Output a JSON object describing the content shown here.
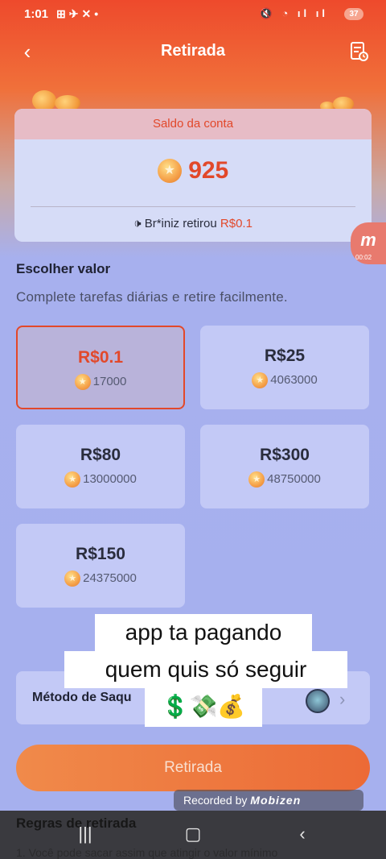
{
  "status_bar": {
    "time": "1:01",
    "battery": "37"
  },
  "header": {
    "title": "Retirada",
    "back_icon": "back-arrow-icon",
    "record_icon": "history-icon"
  },
  "balance": {
    "heading": "Saldo da conta",
    "value": "925",
    "notice_prefix": "Br*iniz retirou ",
    "notice_amount": "R$0.1"
  },
  "section": {
    "title": "Escolher valor",
    "description": "Complete tarefas diárias e retire facilmente."
  },
  "options": [
    {
      "price": "R$0.1",
      "coins": "17000",
      "selected": true
    },
    {
      "price": "R$25",
      "coins": "4063000",
      "selected": false
    },
    {
      "price": "R$80",
      "coins": "13000000",
      "selected": false
    },
    {
      "price": "R$300",
      "coins": "48750000",
      "selected": false
    },
    {
      "price": "R$150",
      "coins": "24375000",
      "selected": false
    }
  ],
  "method": {
    "label": "Método de Saqu"
  },
  "submit_label": "Retirada",
  "overlay_caption": {
    "line1": "app ta pagando",
    "line2": "quem quis só seguir",
    "line3": "💲💸💰"
  },
  "watermark": {
    "prefix": "Recorded by ",
    "brand": "Mobizen"
  },
  "rules": {
    "title": "Regras de retirada",
    "text": "1. Você pode sacar assim que atingir o valor mínimo"
  },
  "float_badge": {
    "timer": "00:02"
  },
  "colors": {
    "accent": "#e2482a",
    "button": "#ec6a36",
    "card": "#c3c9f6"
  }
}
